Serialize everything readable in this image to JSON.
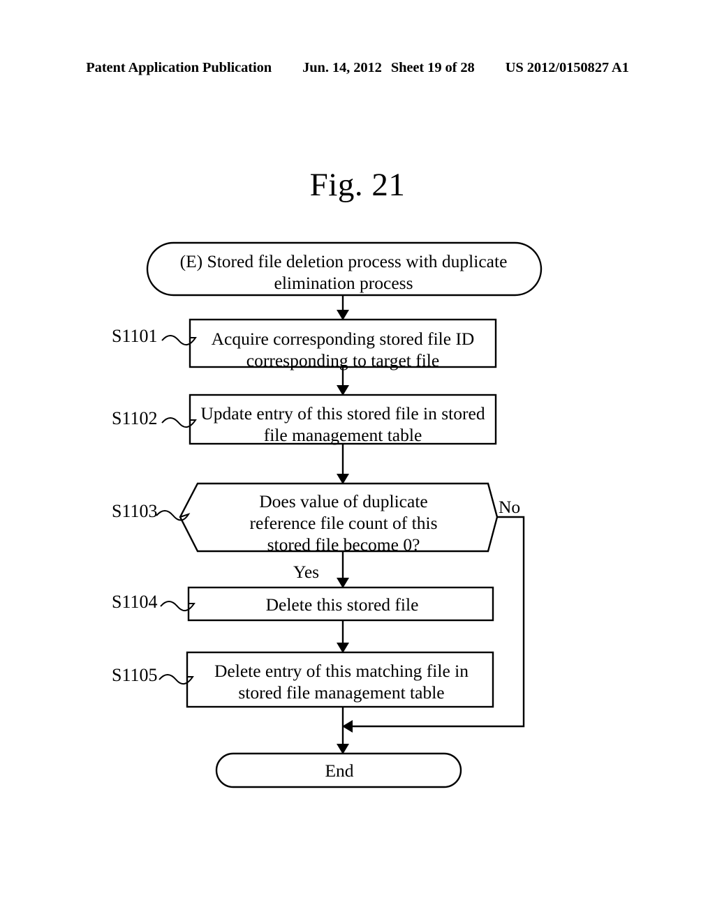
{
  "header": {
    "publication": "Patent Application Publication",
    "date": "Jun. 14, 2012",
    "sheet": "Sheet 19 of 28",
    "publication_number": "US 2012/0150827 A1"
  },
  "figure": {
    "title": "Fig. 21"
  },
  "chart_data": {
    "type": "diagram",
    "diagram_type": "flowchart",
    "title": "Fig. 21",
    "nodes": [
      {
        "id": "start",
        "shape": "stadium",
        "step": "",
        "text": "(E) Stored file deletion process with duplicate\nelimination process"
      },
      {
        "id": "s1101",
        "shape": "rectangle",
        "step": "S1101",
        "text": "Acquire corresponding stored file ID\ncorresponding to target file"
      },
      {
        "id": "s1102",
        "shape": "rectangle",
        "step": "S1102",
        "text": "Update entry of this stored file in stored\nfile management table"
      },
      {
        "id": "s1103",
        "shape": "hexagon",
        "step": "S1103",
        "text": "Does value of duplicate\nreference file count of this\nstored file become 0?"
      },
      {
        "id": "s1104",
        "shape": "rectangle",
        "step": "S1104",
        "text": "Delete this stored file"
      },
      {
        "id": "s1105",
        "shape": "rectangle",
        "step": "S1105",
        "text": "Delete entry of this matching file in\nstored file management table"
      },
      {
        "id": "end",
        "shape": "stadium",
        "step": "",
        "text": "End"
      }
    ],
    "edges": [
      {
        "from": "start",
        "to": "s1101",
        "label": ""
      },
      {
        "from": "s1101",
        "to": "s1102",
        "label": ""
      },
      {
        "from": "s1102",
        "to": "s1103",
        "label": ""
      },
      {
        "from": "s1103",
        "to": "s1104",
        "label": "Yes"
      },
      {
        "from": "s1103",
        "to": "end",
        "label": "No"
      },
      {
        "from": "s1104",
        "to": "s1105",
        "label": ""
      },
      {
        "from": "s1105",
        "to": "end",
        "label": ""
      }
    ],
    "branch_labels": {
      "yes": "Yes",
      "no": "No"
    },
    "colors": {
      "stroke": "#000000",
      "fill": "#ffffff",
      "text": "#000000"
    }
  }
}
